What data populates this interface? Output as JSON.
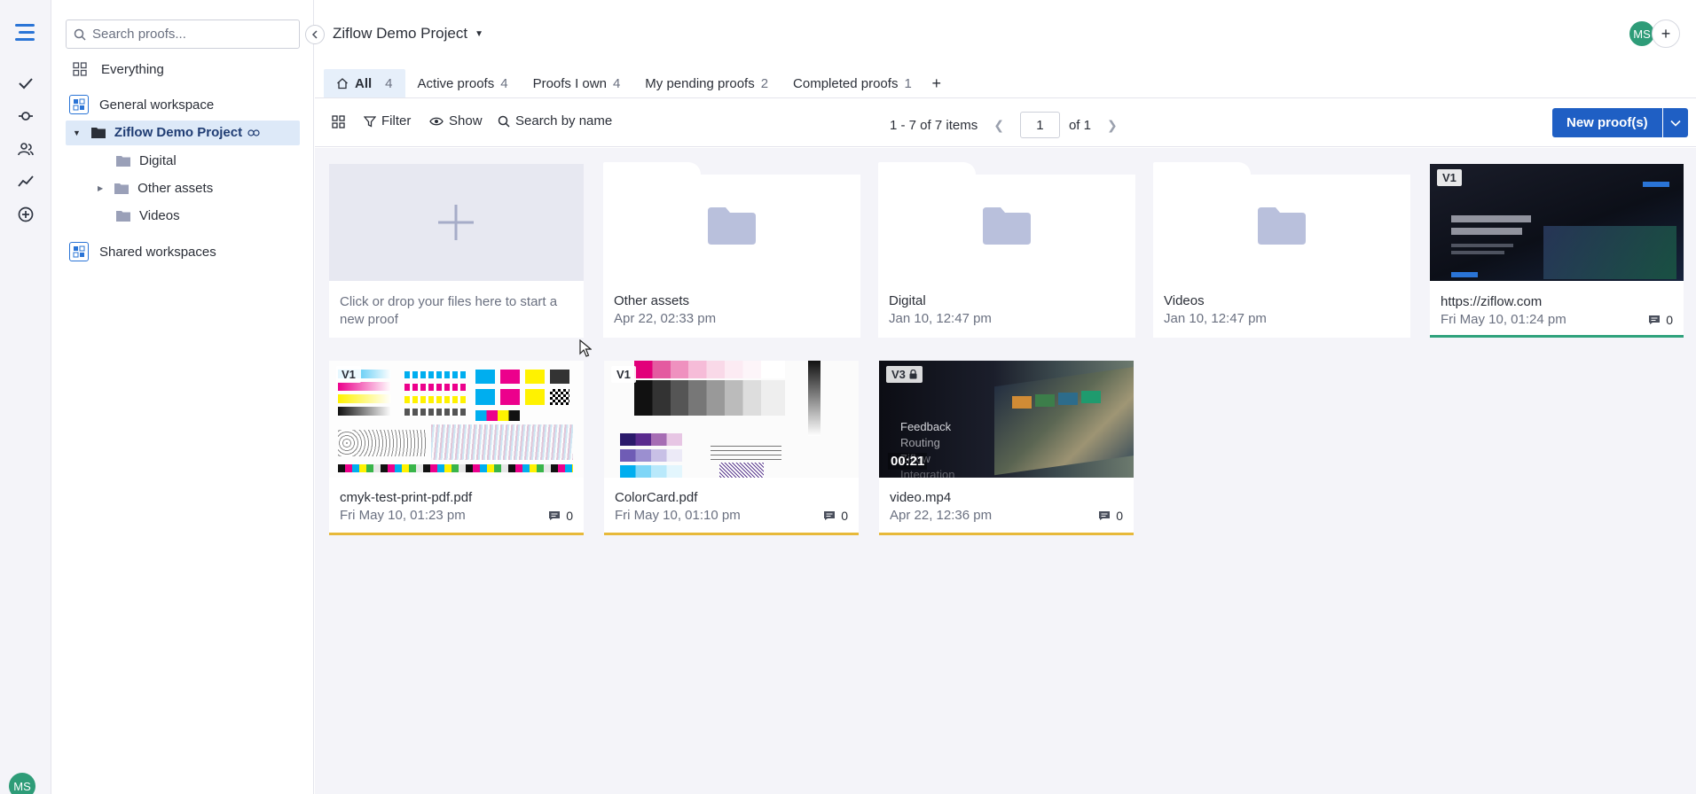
{
  "rail": {
    "avatar": "MS"
  },
  "tree": {
    "search_placeholder": "Search proofs...",
    "items": {
      "everything": "Everything",
      "general_workspace": "General workspace",
      "project": "Ziflow Demo Project",
      "digital": "Digital",
      "other_assets": "Other assets",
      "videos": "Videos",
      "shared_workspaces": "Shared workspaces"
    }
  },
  "header": {
    "project_title": "Ziflow Demo Project",
    "avatar": "MS"
  },
  "tabs": [
    {
      "label": "All",
      "count": "4"
    },
    {
      "label": "Active proofs",
      "count": "4"
    },
    {
      "label": "Proofs I own",
      "count": "4"
    },
    {
      "label": "My pending proofs",
      "count": "2"
    },
    {
      "label": "Completed proofs",
      "count": "1"
    }
  ],
  "toolbar": {
    "filter": "Filter",
    "show": "Show",
    "search_by_name": "Search by name",
    "items_range": "1 - 7 of 7 items",
    "page": "1",
    "page_of": "of 1",
    "new_proofs": "New proof(s)"
  },
  "cards": {
    "upload": {
      "text": "Click or drop your files here to start a new proof"
    },
    "folders": [
      {
        "name": "Other assets",
        "date": "Apr 22, 02:33 pm"
      },
      {
        "name": "Digital",
        "date": "Jan 10, 12:47 pm"
      },
      {
        "name": "Videos",
        "date": "Jan 10, 12:47 pm"
      }
    ],
    "web": {
      "version": "V1",
      "name": "https://ziflow.com",
      "date": "Fri May 10, 01:24 pm",
      "comments": "0"
    },
    "cmyk": {
      "version": "V1",
      "name": "cmyk-test-print-pdf.pdf",
      "date": "Fri May 10, 01:23 pm",
      "comments": "0"
    },
    "colorcard": {
      "version": "V1",
      "name": "ColorCard.pdf",
      "date": "Fri May 10, 01:10 pm",
      "comments": "0"
    },
    "video": {
      "version": "V3",
      "name": "video.mp4",
      "date": "Apr 22, 12:36 pm",
      "comments": "0",
      "duration": "00:21"
    }
  },
  "colors": {
    "accent": "#1f5fc4",
    "avatar": "#2e9c78",
    "status_yellow": "#e7b93a",
    "status_green": "#2fa27c",
    "folder": "#b9c0dc"
  }
}
